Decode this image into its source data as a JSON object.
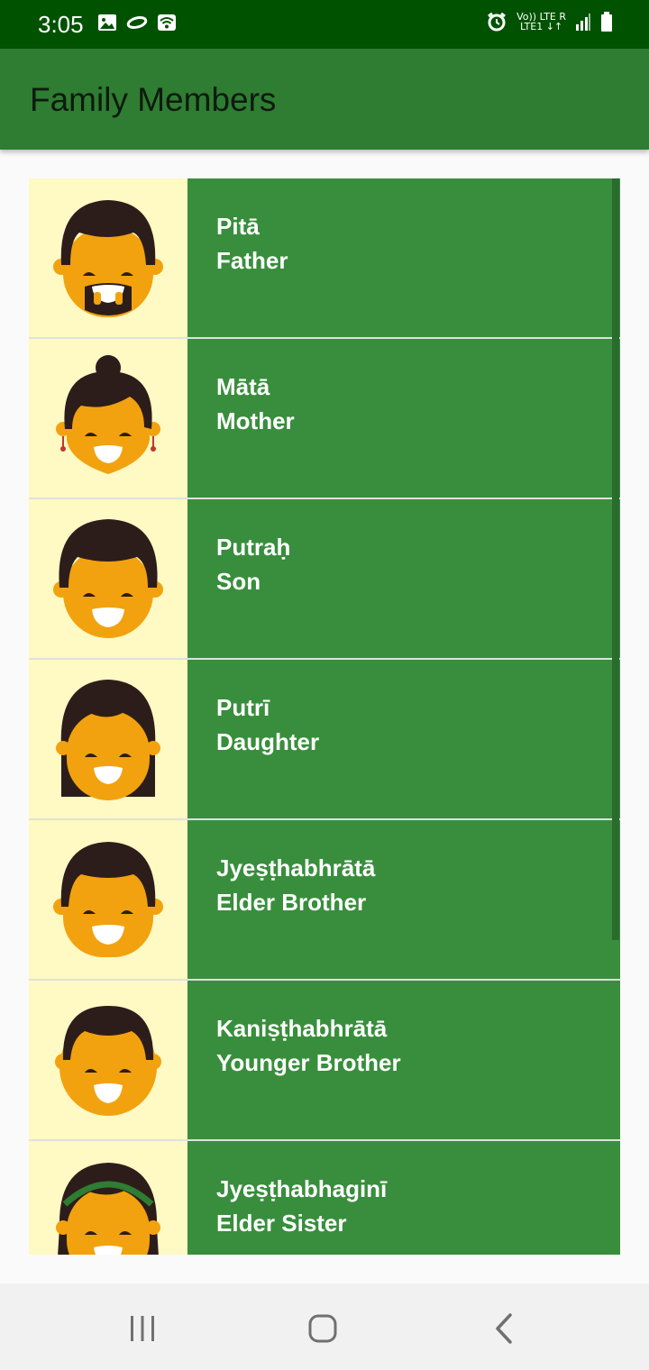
{
  "status_bar": {
    "time": "3:05",
    "network_line1": "Vo)) LTE R",
    "network_line2": "LTE1 ↓↑"
  },
  "app_bar": {
    "title": "Family Members"
  },
  "members": [
    {
      "native": "Pitā",
      "english": "Father",
      "avatar": "father-face"
    },
    {
      "native": "Mātā",
      "english": "Mother",
      "avatar": "mother-face"
    },
    {
      "native": "Putraḥ",
      "english": "Son",
      "avatar": "son-face"
    },
    {
      "native": "Putrī",
      "english": "Daughter",
      "avatar": "daughter-face"
    },
    {
      "native": "Jyeṣṭhabhrātā",
      "english": "Elder Brother",
      "avatar": "elder-brother-face"
    },
    {
      "native": "Kaniṣṭhabhrātā",
      "english": "Younger Brother",
      "avatar": "younger-brother-face"
    },
    {
      "native": "Jyeṣṭhabhaginī",
      "english": "Elder Sister",
      "avatar": "elder-sister-face"
    }
  ],
  "colors": {
    "status_bar": "#005200",
    "app_bar": "#2e7d32",
    "row_text_bg": "#388e3c",
    "avatar_bg": "#fff9c4",
    "skin": "#f2a20e",
    "hair": "#2d1d1a"
  },
  "nav": {
    "icons": [
      "recents-icon",
      "home-icon",
      "back-icon"
    ]
  }
}
